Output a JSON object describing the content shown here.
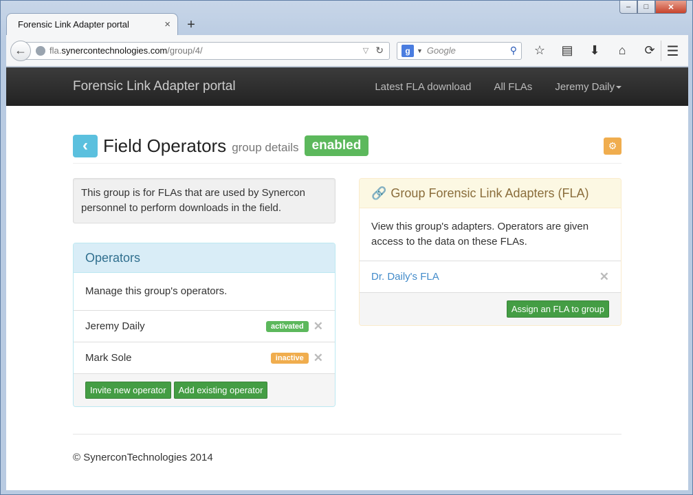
{
  "browser": {
    "tab_title": "Forensic Link Adapter portal",
    "tab_close": "×",
    "new_tab": "+",
    "url_prefix": "fla.",
    "url_domain": "synercontechnologies.com",
    "url_path": "/group/4/",
    "search_placeholder": "Google",
    "window_min": "–",
    "window_max": "□",
    "window_close": "✕"
  },
  "site": {
    "brand": "Forensic Link Adapter portal",
    "nav": {
      "latest": "Latest FLA download",
      "all": "All FLAs",
      "user": "Jeremy Daily"
    }
  },
  "header": {
    "title": "Field Operators",
    "subtitle": "group details",
    "status": "enabled"
  },
  "description": "This group is for FLAs that are used by Synercon personnel to perform downloads in the field.",
  "operators": {
    "heading": "Operators",
    "body": "Manage this group's operators.",
    "rows": [
      {
        "name": "Jeremy Daily",
        "status": "activated"
      },
      {
        "name": "Mark Sole",
        "status": "inactive"
      }
    ],
    "invite_button": "Invite new operator",
    "add_button": "Add existing operator"
  },
  "adapters": {
    "heading": "Group Forensic Link Adapters (FLA)",
    "body": "View this group's adapters. Operators are given access to the data on these FLAs.",
    "rows": [
      {
        "name": "Dr. Daily's FLA"
      }
    ],
    "assign_button": "Assign an FLA to group"
  },
  "footer": {
    "copyright": "© SynerconTechnologies 2014"
  },
  "colors": {
    "info": "#5bc0de",
    "success": "#5cb85c",
    "warning": "#f0ad4e",
    "navbar": "#222222"
  },
  "icons": {
    "back": "chevron-left-icon",
    "gear": "gear-icon",
    "link": "link-icon",
    "remove": "close-icon"
  }
}
